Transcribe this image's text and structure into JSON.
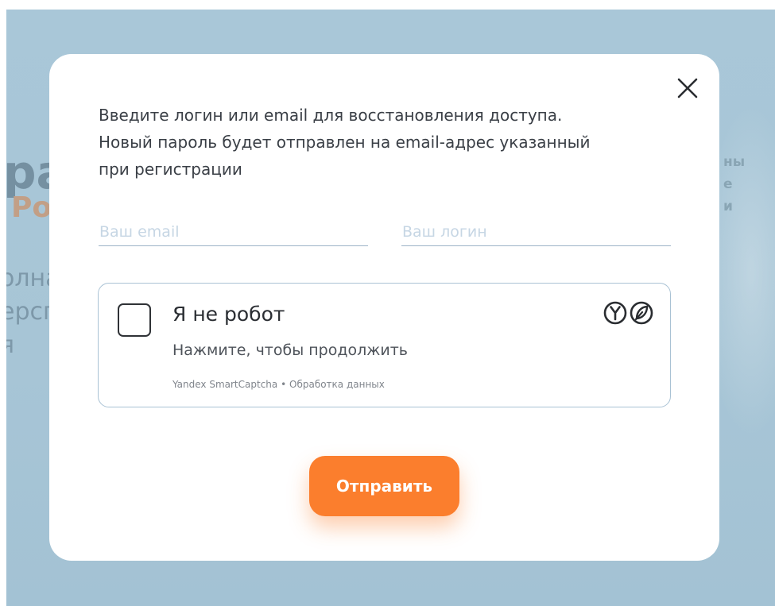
{
  "background": {
    "heading": "pa",
    "subheading": "Po",
    "lines": "олна\nерсп\nя",
    "right_text": "ны\nе\nи"
  },
  "modal": {
    "intro": {
      "line1": "Введите логин или email для восстановления доступа.",
      "line2": "Новый пароль будет отправлен на email-адрес указанный",
      "line3": "при регистрации"
    },
    "email_field": {
      "value": "",
      "placeholder": "Ваш email"
    },
    "login_field": {
      "value": "",
      "placeholder": "Ваш логин"
    },
    "captcha": {
      "title": "Я не робот",
      "hint": "Нажмите, чтобы продолжить",
      "brand": "Yandex SmartCaptcha",
      "separator": "•",
      "data_link": "Обработка данных",
      "logo_icon": "yandex-smartcaptcha-logo",
      "checked": false
    },
    "submit_label": "Отправить",
    "close_icon": "close-icon"
  },
  "colors": {
    "accent": "#fb7e2d",
    "backdrop": "#a9c7d8",
    "input_border": "#9db4c7",
    "placeholder": "#c6d6e4"
  }
}
